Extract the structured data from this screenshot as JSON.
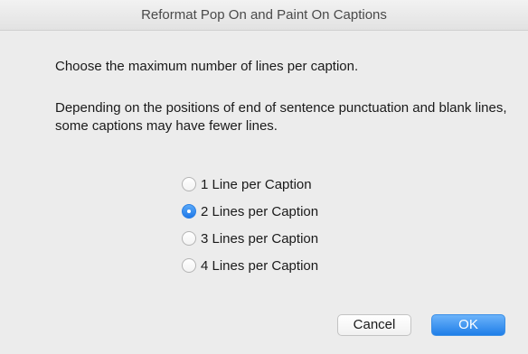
{
  "window": {
    "title": "Reformat Pop On and Paint On Captions"
  },
  "content": {
    "prompt": "Choose the maximum number of lines per caption.",
    "note": "Depending on the positions of end of sentence punctuation and blank lines, some captions may have fewer lines."
  },
  "options": [
    {
      "label": "1 Line per Caption",
      "checked": false
    },
    {
      "label": "2 Lines per Caption",
      "checked": true
    },
    {
      "label": "3 Lines per Caption",
      "checked": false
    },
    {
      "label": "4 Lines per Caption",
      "checked": false
    }
  ],
  "buttons": {
    "cancel": "Cancel",
    "ok": "OK"
  },
  "colors": {
    "accent": "#1f7ee8",
    "background": "#ececec"
  }
}
